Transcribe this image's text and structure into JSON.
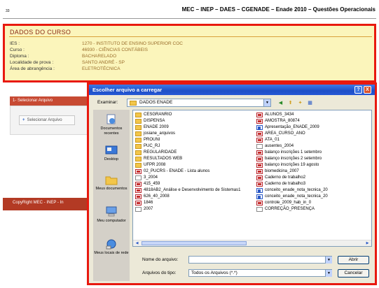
{
  "page": {
    "number": "33",
    "header": "MEC – INEP – DAES – CGENADE – Enade 2010 – Questões Operacionais"
  },
  "course": {
    "title": "DADOS DO CURSO",
    "rows": [
      {
        "label": "IES :",
        "value": "1270 - INSTITUTO DE ENSINO SUPERIOR COC"
      },
      {
        "label": "Curso :",
        "value": "46930 - CIÊNCIAS CONTÁBEIS"
      },
      {
        "label": "Diploma :",
        "value": "BACHARELADO"
      },
      {
        "label": "Localidade de prova :",
        "value": "SANTO ANDRÉ - SP"
      },
      {
        "label": "Área de abrangência :",
        "value": "ELETROTÉCNICA"
      }
    ]
  },
  "background_page": {
    "step_label": "1- Selecionar Arquivo",
    "select_button": "Selecionar Arquivo",
    "footer": "CopyRight MEC - INEP - In"
  },
  "dialog": {
    "title": "Escolher arquivo a carregar",
    "help_glyph": "?",
    "close_glyph": "X",
    "look_in_label": "Examinar:",
    "look_in_value": "DADOS ENADE",
    "places": [
      {
        "label": "Documentos recentes",
        "icon": "recent-documents-icon"
      },
      {
        "label": "Desktop",
        "icon": "desktop-icon"
      },
      {
        "label": "Meus documentos",
        "icon": "my-documents-icon"
      },
      {
        "label": "Meu computador",
        "icon": "my-computer-icon"
      },
      {
        "label": "Meus locais de rede",
        "icon": "network-places-icon"
      }
    ],
    "files_col1": [
      {
        "name": "CESGRANRIO",
        "type": "folder"
      },
      {
        "name": "DISPENSA",
        "type": "folder"
      },
      {
        "name": "ENADE 2009",
        "type": "folder"
      },
      {
        "name": "josiane_arquivos",
        "type": "folder"
      },
      {
        "name": "PROUNI",
        "type": "folder"
      },
      {
        "name": "PUC_RJ",
        "type": "folder"
      },
      {
        "name": "REGULARIDADE",
        "type": "folder"
      },
      {
        "name": "RESULTADOS WEB",
        "type": "folder"
      },
      {
        "name": "UFPR 2008",
        "type": "folder"
      },
      {
        "name": "02_PUCRS - ENADE - Lista alunos",
        "type": "pdf"
      },
      {
        "name": "3_2004",
        "type": "txt"
      },
      {
        "name": "415_459",
        "type": "pdf"
      },
      {
        "name": "4818AB2_Análise e Desenvolvimento de Sistemas1",
        "type": "pdf"
      },
      {
        "name": "626_40_2008",
        "type": "pdf"
      },
      {
        "name": "1846",
        "type": "pdf"
      },
      {
        "name": "2007",
        "type": "txt"
      }
    ],
    "files_col2": [
      {
        "name": "ALUNOS_3434",
        "type": "pdf"
      },
      {
        "name": "AMOSTRA_80874",
        "type": "pdf"
      },
      {
        "name": "Apresentação_ENADE_2009",
        "type": "doc"
      },
      {
        "name": "AREA_CURSO_ANO",
        "type": "pdf"
      },
      {
        "name": "ATA_01",
        "type": "pdf"
      },
      {
        "name": "ausentes_2004",
        "type": "txt"
      },
      {
        "name": "balanço inscrições 1 setembro",
        "type": "pdf"
      },
      {
        "name": "balanço inscrições 2 setembro",
        "type": "pdf"
      },
      {
        "name": "balanço inscrições 19 agosto",
        "type": "pdf"
      },
      {
        "name": "biomedicina_2007",
        "type": "pdf"
      },
      {
        "name": "Caderno de trabalho2",
        "type": "pdf"
      },
      {
        "name": "Caderno de trabalho3",
        "type": "pdf"
      },
      {
        "name": "conceito_enade_nota_tecnica_20",
        "type": "doc"
      },
      {
        "name": "conceito_enade_nota_tecnica_20",
        "type": "doc"
      },
      {
        "name": "controle_2009_hab_in_0",
        "type": "pdf"
      },
      {
        "name": "CORREÇÃO_PRESENÇA",
        "type": "txt"
      }
    ],
    "file_name_label": "Nome do arquivo:",
    "file_name_value": "",
    "file_type_label": "Arquivos do tipo:",
    "file_type_value": "Todos os Arquivos (*.*)",
    "open_button": "Abrir",
    "cancel_button": "Cancelar"
  },
  "colors": {
    "highlight_border": "#e8190f",
    "panel_bg": "#fbf5bb",
    "title_bar": "#1d4fc7",
    "footer_bar": "#b33a24"
  }
}
